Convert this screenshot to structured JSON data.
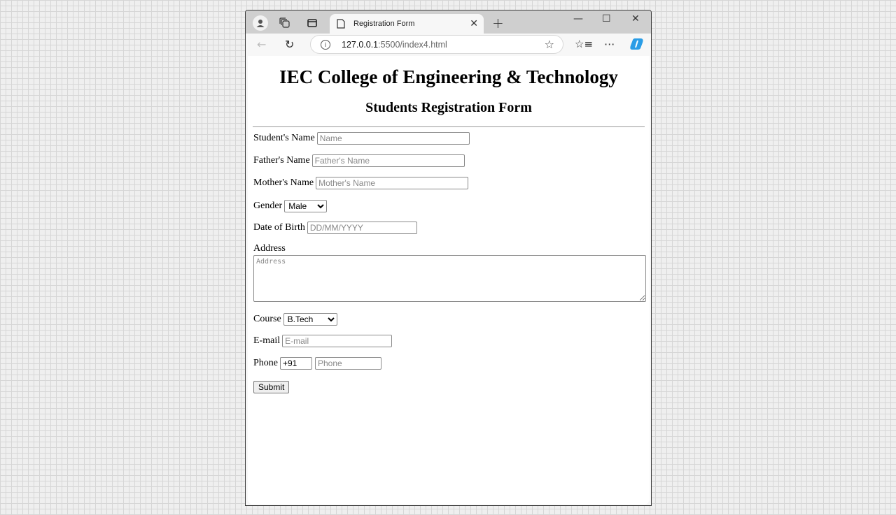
{
  "browser": {
    "tab_title": "Registration Form",
    "url_host": "127.0.0.1",
    "url_path": ":5500/index4.html",
    "icons": {
      "profile": "person-circle-icon",
      "workspaces": "workspaces-icon",
      "tab_actions": "vertical-tabs-icon",
      "page": "document-icon",
      "close_tab": "close-icon",
      "new_tab": "plus-icon",
      "minimize": "minimize-icon",
      "maximize": "maximize-icon",
      "close_window": "close-icon",
      "back": "back-arrow-icon",
      "refresh": "refresh-icon",
      "site_info": "info-icon",
      "favorite": "star-icon",
      "favorites_list": "favorites-icon",
      "more": "ellipsis-icon",
      "copilot": "copilot-icon"
    }
  },
  "page": {
    "college_title": "IEC College of Engineering & Technology",
    "form_title": "Students Registration Form",
    "fields": {
      "student_name": {
        "label": "Student's Name",
        "placeholder": "Name"
      },
      "father_name": {
        "label": "Father's Name",
        "placeholder": "Father's Name"
      },
      "mother_name": {
        "label": "Mother's Name",
        "placeholder": "Mother's Name"
      },
      "gender": {
        "label": "Gender",
        "selected": "Male"
      },
      "dob": {
        "label": "Date of Birth",
        "placeholder": "DD/MM/YYYY"
      },
      "address": {
        "label": "Address",
        "placeholder": "Address"
      },
      "course": {
        "label": "Course",
        "selected": "B.Tech"
      },
      "email": {
        "label": "E-mail",
        "placeholder": "E-mail"
      },
      "phone": {
        "label": "Phone",
        "code_value": "+91",
        "placeholder": "Phone"
      }
    },
    "submit_label": "Submit"
  }
}
